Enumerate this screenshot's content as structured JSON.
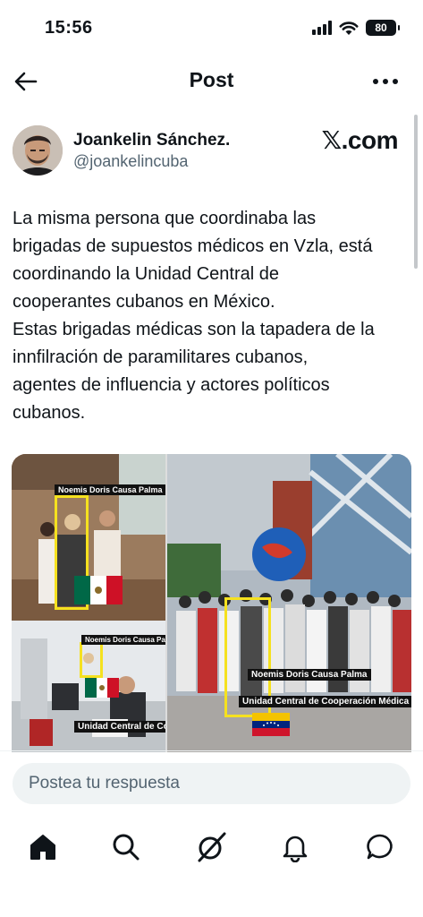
{
  "status": {
    "time": "15:56",
    "battery": "80"
  },
  "header": {
    "title": "Post"
  },
  "post": {
    "author_name": "Joankelin Sánchez.",
    "author_handle": "@joankelincuba",
    "brand": "𝕏.com",
    "text_lines": [
      "La misma persona que coordinaba las",
      "brigadas de supuestos médicos en Vzla, está",
      "coordinando la Unidad Central de",
      "cooperantes cubanos en México.",
      "Estas brigadas médicas son la tapadera de la",
      "innfilración de paramilitares cubanos,",
      "agentes de influencia y actores políticos",
      "cubanos."
    ],
    "media": {
      "label_name_1": "Noemis Doris Causa Palma",
      "label_name_2": "Noemis Doris Causa Palma",
      "label_name_3": "Noemis Doris Causa Palma",
      "label_unit_1": "Unidad Central de Cooperación Médica",
      "label_unit_2": "Unidad Central de Cooperación Médica"
    }
  },
  "reply": {
    "placeholder": "Postea tu respuesta"
  },
  "tabs": [
    "home",
    "search",
    "grok",
    "notifications",
    "messages"
  ],
  "colors": {
    "text": "#0f1419",
    "secondary": "#536471",
    "reply_bg": "#eff3f4",
    "highlight": "#f5e11f"
  }
}
